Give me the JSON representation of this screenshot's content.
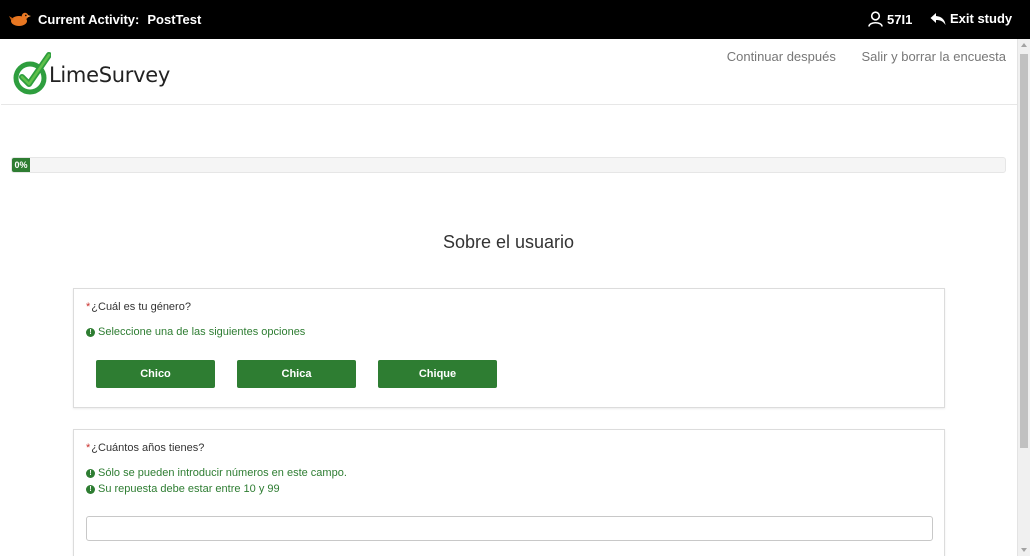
{
  "topbar": {
    "activity_label": "Current Activity:",
    "activity_value": "PostTest",
    "user_id": "57I1",
    "exit_label": "Exit study"
  },
  "header": {
    "logo_text": "LimeSurvey",
    "links": [
      "Continuar después",
      "Salir y borrar la encuesta"
    ]
  },
  "progress": {
    "percent": 0,
    "label": "0%"
  },
  "group": {
    "title": "Sobre el usuario"
  },
  "questions": [
    {
      "text": "¿Cuál es tu género?",
      "mandatory": "*",
      "help": [
        "Seleccione una de las siguientes opciones"
      ],
      "options": [
        "Chico",
        "Chica",
        "Chique"
      ]
    },
    {
      "text": "¿Cuántos años tienes?",
      "mandatory": "*",
      "help": [
        "Sólo se pueden introducir números en este campo.",
        "Su repuesta debe estar entre 10 y 99"
      ],
      "value": ""
    }
  ],
  "colors": {
    "topbar": "#000000",
    "accent_green": "#2e7d32",
    "mandatory_red": "#c9302c"
  },
  "icons": {
    "app_logo": "orange-bird-icon",
    "user": "user-icon",
    "exit": "reply-arrow-icon",
    "ls_logo": "limesurvey-check-logo",
    "help": "exclamation-circle-icon"
  }
}
